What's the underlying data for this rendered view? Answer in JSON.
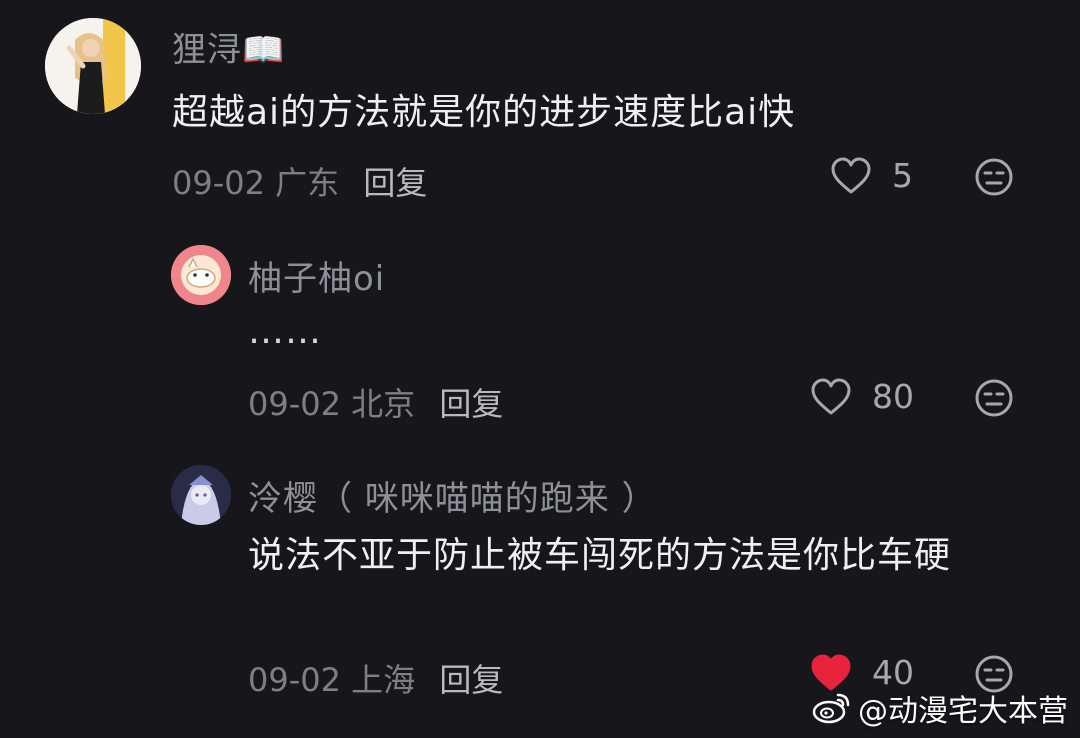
{
  "comments": [
    {
      "username": "狸浔📖",
      "text": "超越ai的方法就是你的进步速度比ai快",
      "date": "09-02",
      "location": "广东",
      "reply_label": "回复",
      "likes": "5",
      "liked": false
    },
    {
      "username": "柚子柚oi",
      "text": "……",
      "date": "09-02",
      "location": "北京",
      "reply_label": "回复",
      "likes": "80",
      "liked": false
    },
    {
      "username": "泠樱（ 咪咪喵喵的跑来 ）",
      "text": "说法不亚于防止被车闯死的方法是你比车硬",
      "date": "09-02",
      "location": "上海",
      "reply_label": "回复",
      "likes": "40",
      "liked": true
    }
  ],
  "watermark": {
    "text": "@动漫宅大本营",
    "icon": "weibo-icon"
  },
  "colors": {
    "background": "#17161b",
    "liked_heart": "#e8243c",
    "muted_text": "#8f8f96"
  },
  "icons": {
    "like": "heart-outline-icon",
    "liked": "heart-filled-icon",
    "dislike": "meh-face-icon"
  }
}
